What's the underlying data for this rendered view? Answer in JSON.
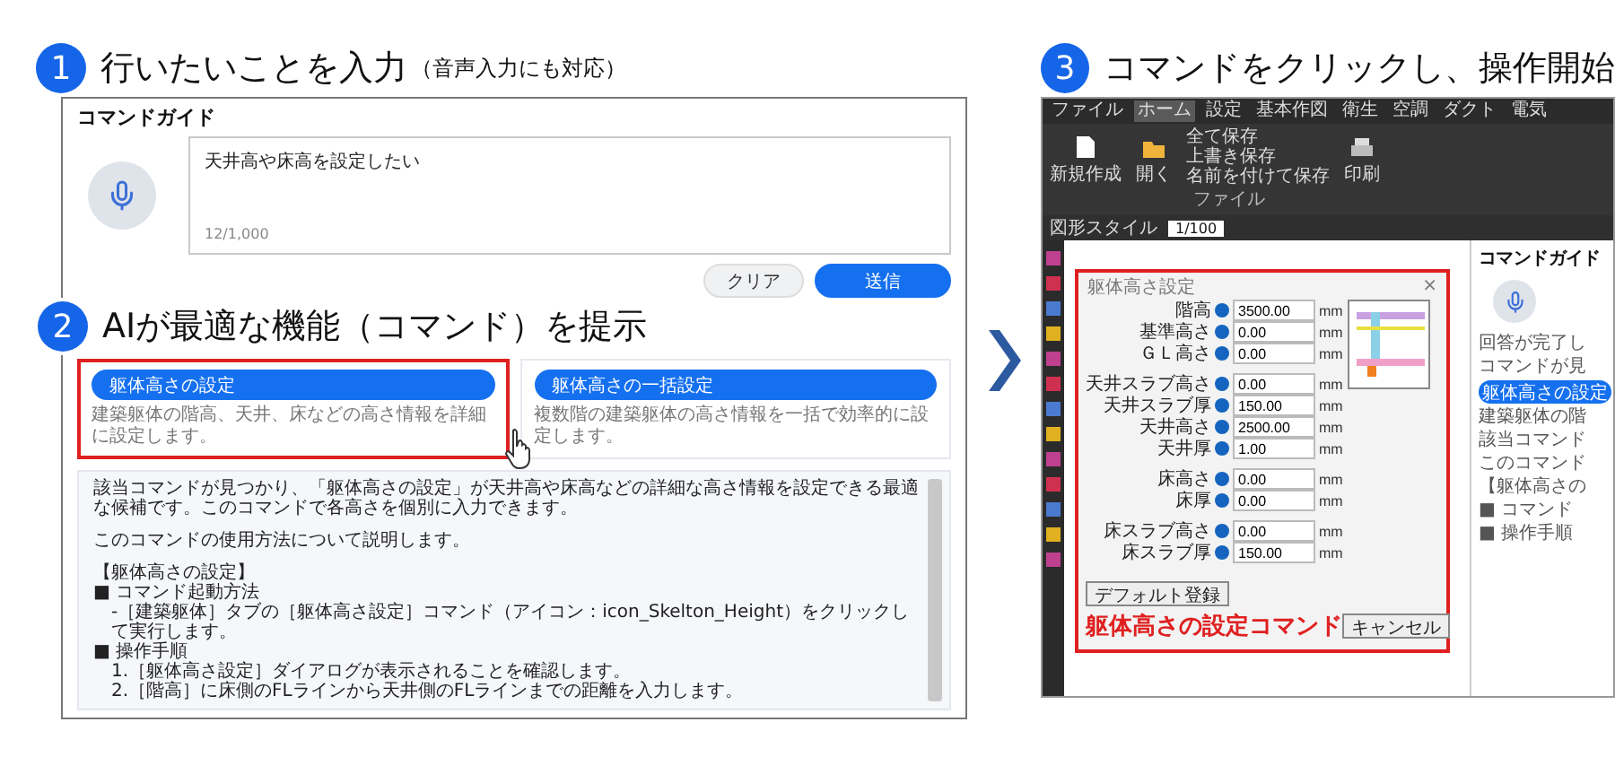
{
  "steps": [
    {
      "number": "1",
      "title": "行いたいことを入力",
      "note": "（音声入力にも対応）"
    },
    {
      "number": "2",
      "title": "AIが最適な機能（コマンド）を提示"
    },
    {
      "number": "3",
      "title": "コマンドをクリックし、操作開始"
    }
  ],
  "guide": {
    "title": "コマンドガイド",
    "input": {
      "value": "天井高や床高を設定したい",
      "counter": "12/1,000"
    },
    "buttons": [
      {
        "label": "クリア",
        "kind": "secondary"
      },
      {
        "label": "送信",
        "kind": "primary"
      }
    ],
    "suggestions": [
      {
        "title": "躯体高さの設定",
        "description": "建築躯体の階高、天井、床などの高さ情報を詳細に設定します。",
        "selected": true
      },
      {
        "title": "躯体高さの一括設定",
        "description": "複数階の建築躯体の高さ情報を一括で効率的に設定します。",
        "selected": false
      }
    ],
    "answer": {
      "lines": [
        {
          "text": "該当コマンドが見つかり、「躯体高さの設定」が天井高や床高などの詳細な高さ情報を設定できる最適な候補です。このコマンドで各高さを個別に入力できます。",
          "gap_before": false,
          "indent": false
        },
        {
          "text": "このコマンドの使用方法について説明します。",
          "gap_before": true,
          "indent": false
        },
        {
          "text": "【躯体高さの設定】",
          "gap_before": true,
          "indent": false
        },
        {
          "text": "■ コマンド起動方法",
          "gap_before": false,
          "indent": false
        },
        {
          "text": "-［建築躯体］タブの［躯体高さ設定］コマンド（アイコン：icon_Skelton_Height）をクリックして実行します。",
          "gap_before": false,
          "indent": true
        },
        {
          "text": "■ 操作手順",
          "gap_before": false,
          "indent": false
        },
        {
          "text": "1.［躯体高さ設定］ダイアログが表示されることを確認します。",
          "gap_before": false,
          "indent": true
        },
        {
          "text": "2.［階高］に床側のFLラインから天井側のFLラインまでの距離を入力します。",
          "gap_before": false,
          "indent": true
        }
      ]
    }
  },
  "app": {
    "menu": [
      {
        "label": "ファイル",
        "selected": false
      },
      {
        "label": "ホーム",
        "selected": true
      },
      {
        "label": "設定",
        "selected": false
      },
      {
        "label": "基本作図",
        "selected": false
      },
      {
        "label": "衛生",
        "selected": false
      },
      {
        "label": "空調",
        "selected": false
      },
      {
        "label": "ダクト",
        "selected": false
      },
      {
        "label": "電気",
        "selected": false
      }
    ],
    "ribbon": {
      "tools": [
        {
          "kind": "new",
          "label": "新規作成"
        },
        {
          "kind": "open",
          "label": "開く"
        },
        {
          "kind": "save_list",
          "items": [
            "全て保存",
            "上書き保存",
            "名前を付けて保存"
          ]
        },
        {
          "kind": "print",
          "label": "印刷"
        }
      ],
      "group": "ファイル"
    },
    "toolbar": {
      "style_label": "図形スタイル",
      "scale": "1/100"
    },
    "dialog": {
      "title": "躯体高さ設定",
      "close": "×",
      "field_groups": [
        [
          {
            "label": "階高",
            "value": "3500.00",
            "unit": "mm"
          },
          {
            "label": "基準高さ",
            "value": "0.00",
            "unit": "mm"
          },
          {
            "label": "ＧＬ高さ",
            "value": "0.00",
            "unit": "mm"
          }
        ],
        [
          {
            "label": "天井スラブ高さ",
            "value": "0.00",
            "unit": "mm"
          },
          {
            "label": "天井スラブ厚",
            "value": "150.00",
            "unit": "mm"
          },
          {
            "label": "天井高さ",
            "value": "2500.00",
            "unit": "mm"
          },
          {
            "label": "天井厚",
            "value": "1.00",
            "unit": "mm"
          }
        ],
        [
          {
            "label": "床高さ",
            "value": "0.00",
            "unit": "mm"
          },
          {
            "label": "床厚",
            "value": "0.00",
            "unit": "mm"
          }
        ],
        [
          {
            "label": "床スラブ高さ",
            "value": "0.00",
            "unit": "mm"
          },
          {
            "label": "床スラブ厚",
            "value": "150.00",
            "unit": "mm"
          }
        ]
      ],
      "default_button": "デフォルト登録",
      "cancel_button": "キャンセル",
      "caption": "躯体高さの設定コマンド"
    },
    "side_panel": {
      "title": "コマンドガイド",
      "lines_top": [
        "回答が完了し",
        "コマンドが見"
      ],
      "button": "躯体高さの設定",
      "lines": [
        "建築躯体の階",
        "該当コマンド",
        "このコマンド",
        "【躯体高さの",
        "■ コマンド",
        "■ 操作手順"
      ]
    }
  }
}
